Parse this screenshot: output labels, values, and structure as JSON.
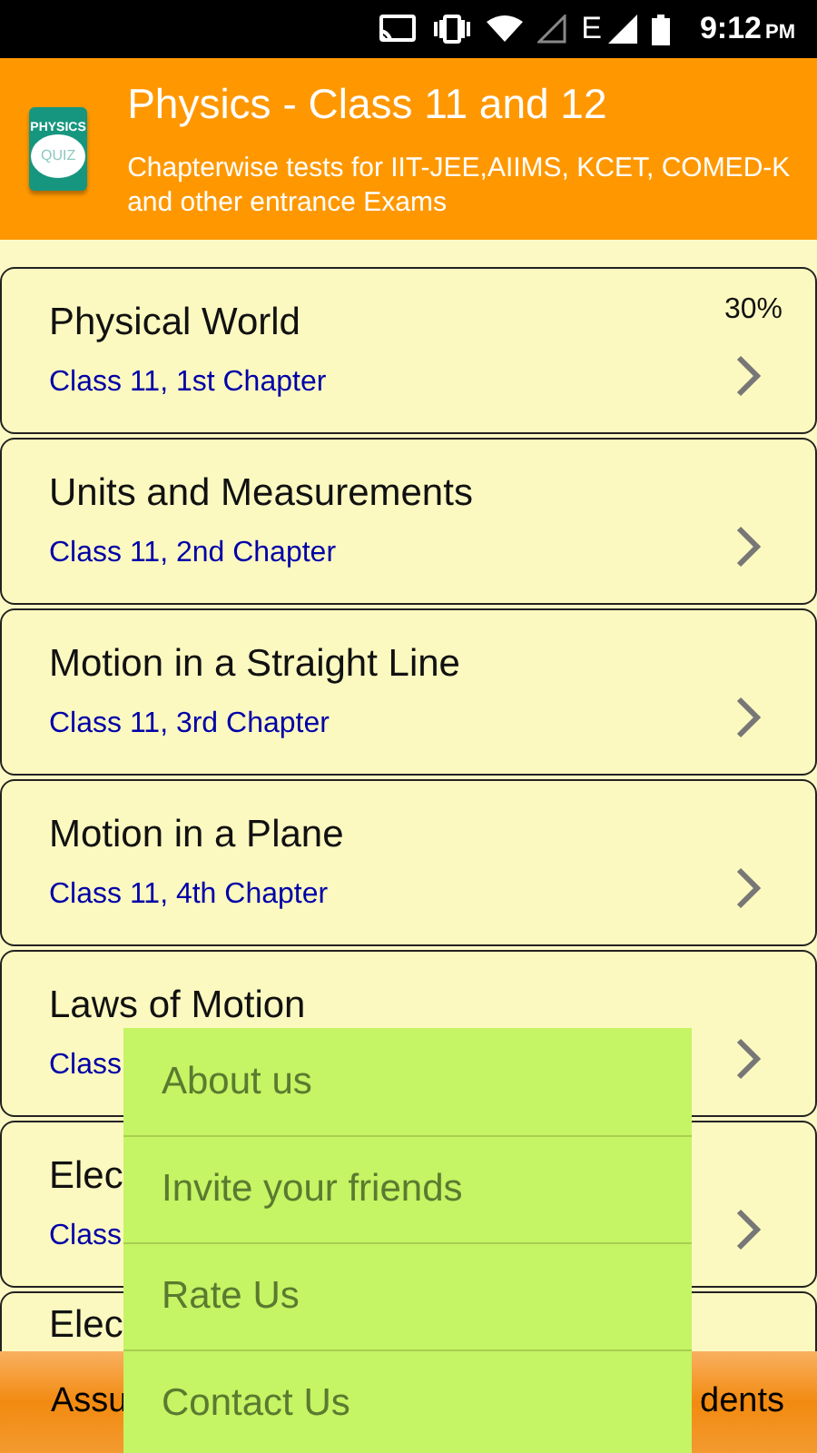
{
  "status_bar": {
    "network": "E",
    "time": "9:12",
    "ampm": "PM"
  },
  "header": {
    "logo_top": "PHYSICS",
    "logo_bottom": "QUIZ",
    "title": "Physics - Class 11 and 12",
    "subtitle": "Chapterwise tests for IIT-JEE,AIIMS, KCET, COMED-K and other entrance Exams"
  },
  "chapters": [
    {
      "title": "Physical World",
      "subtitle": "Class 11, 1st Chapter",
      "progress": "30%"
    },
    {
      "title": "Units and Measurements",
      "subtitle": "Class 11, 2nd Chapter"
    },
    {
      "title": "Motion in a Straight Line",
      "subtitle": "Class 11, 3rd Chapter"
    },
    {
      "title": "Motion in a Plane",
      "subtitle": "Class 11, 4th Chapter"
    },
    {
      "title": "Laws of Motion",
      "subtitle": "Class"
    },
    {
      "title": "Elec",
      "subtitle": "Class"
    },
    {
      "title": "Elec"
    }
  ],
  "bottom_bar": {
    "left": "Assu",
    "right": "dents"
  },
  "menu": [
    "About us",
    "Invite your friends",
    "Rate Us",
    "Contact Us"
  ]
}
